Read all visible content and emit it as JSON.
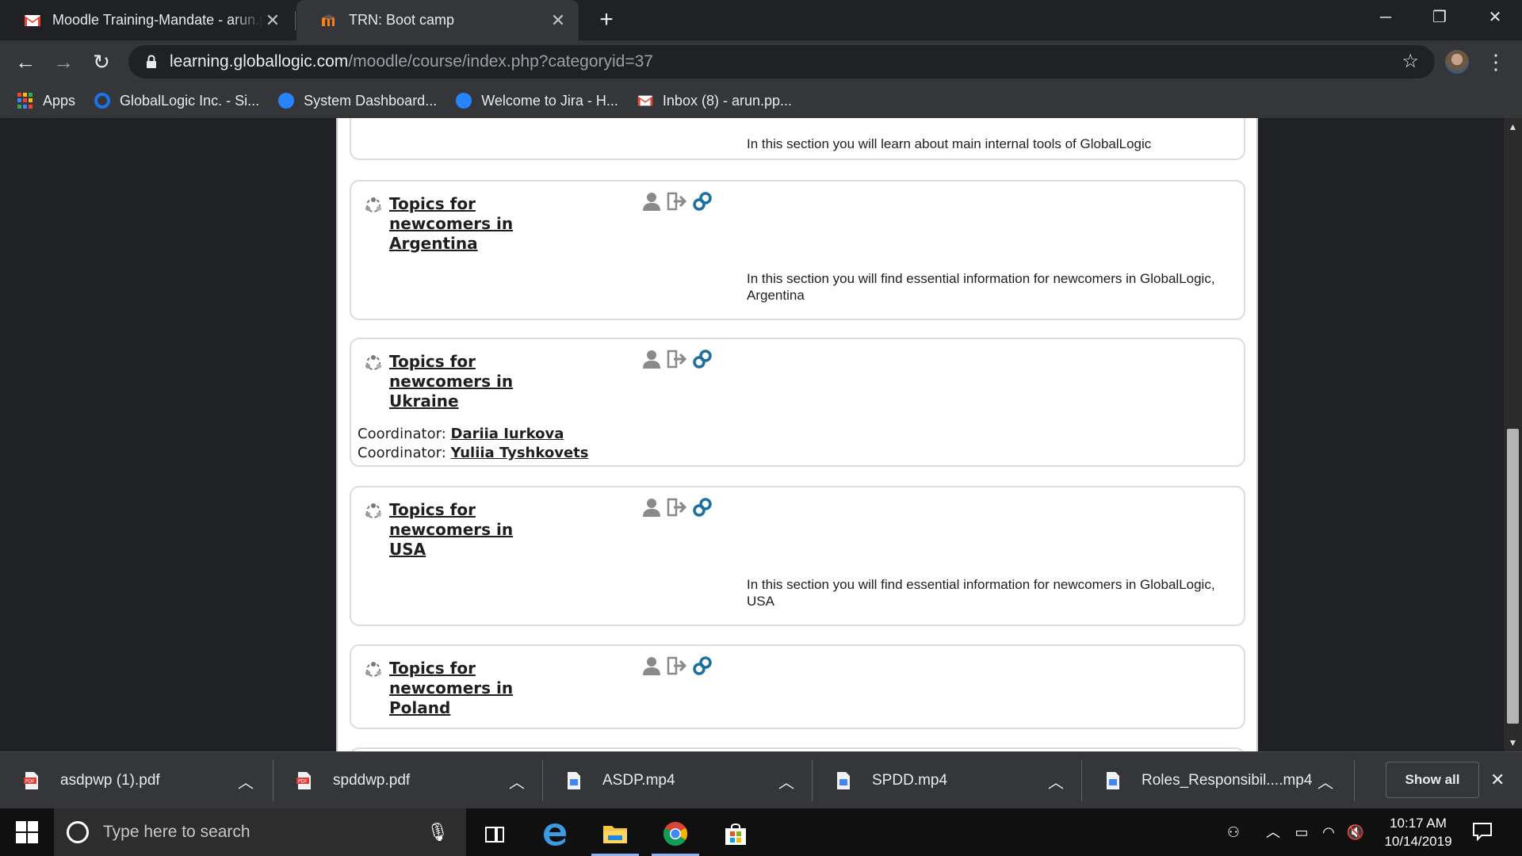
{
  "browser": {
    "tabs": [
      {
        "title": "Moodle Training-Mandate - arun.pp@globallogic.com - GlobalLogic Mail",
        "favicon": "gmail-icon",
        "active": false
      },
      {
        "title": "TRN: Boot camp",
        "favicon": "moodle-icon",
        "active": true
      }
    ],
    "address": {
      "domain": "learning.globallogic.com",
      "path": "/moodle/course/index.php?categoryid=37"
    },
    "bookmarks": [
      {
        "label": "Apps",
        "icon": "apps-grid-icon"
      },
      {
        "label": "GlobalLogic Inc. - Si...",
        "icon": "globallogic-icon"
      },
      {
        "label": "System Dashboard...",
        "icon": "jira-icon"
      },
      {
        "label": "Welcome to Jira - H...",
        "icon": "jira-icon"
      },
      {
        "label": "Inbox (8) - arun.pp...",
        "icon": "gmail-icon"
      }
    ]
  },
  "page": {
    "top_fragment_desc": "In this section you will learn about main internal tools of GlobalLogic",
    "categories": [
      {
        "title": "Topics for newcomers in Argentina",
        "description": "In this section you will find essential information for newcomers in GlobalLogic, Argentina"
      },
      {
        "title": "Topics for newcomers in Ukraine",
        "coordinators": [
          {
            "label": "Coordinator:",
            "name": "Dariia Iurkova"
          },
          {
            "label": "Coordinator:",
            "name": "Yuliia Tyshkovets"
          }
        ]
      },
      {
        "title": "Topics for newcomers in USA",
        "description": "In this section you will find essential information for newcomers in GlobalLogic, USA"
      },
      {
        "title": "Topics for newcomers in Poland"
      }
    ]
  },
  "downloads": {
    "items": [
      {
        "name": "asdpwp (1).pdf",
        "type": "pdf"
      },
      {
        "name": "spddwp.pdf",
        "type": "pdf"
      },
      {
        "name": "ASDP.mp4",
        "type": "video"
      },
      {
        "name": "SPDD.mp4",
        "type": "video"
      },
      {
        "name": "Roles_Responsibil....mp4",
        "type": "video"
      }
    ],
    "show_all": "Show all"
  },
  "taskbar": {
    "search_placeholder": "Type here to search",
    "time": "10:17 AM",
    "date": "10/14/2019"
  },
  "colors": {
    "chrome_dark": "#202124",
    "chrome_toolbar": "#35363a",
    "link_dark": "#1f1f1f",
    "card_border": "#dcdcdc"
  }
}
